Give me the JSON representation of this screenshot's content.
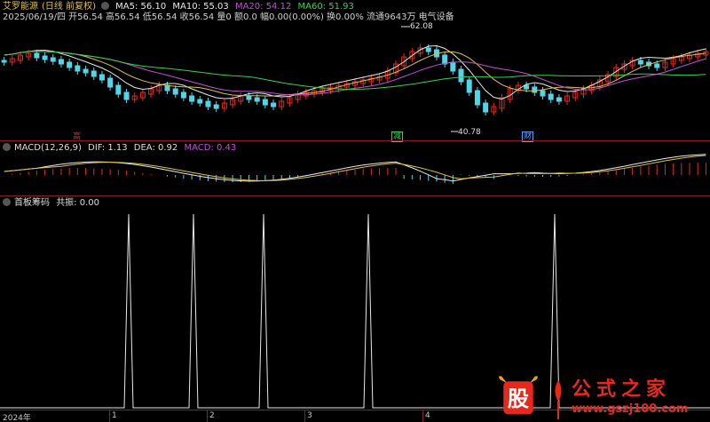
{
  "header": {
    "stock_name": "艾罗能源",
    "period": "(日线 前复权)",
    "ma": [
      {
        "label": "MA5: 56.10",
        "color": "#e8e8e8"
      },
      {
        "label": "MA10: 55.03",
        "color": "#e8e8e8"
      },
      {
        "label": "MA20: 54.12",
        "color": "#c34fd6"
      },
      {
        "label": "MA60: 51.93",
        "color": "#33d44a"
      }
    ],
    "quote": "2025/06/19/四 开56.54 高56.54 低56.54 收56.54 量0 额0.0 幅0.00(0.00%) 换0.00% 流通9643万 电气设备"
  },
  "price_panel": {
    "high_marker": "62.08",
    "low_marker": "40.78",
    "tags": [
      {
        "text": "高",
        "color": "#e8281b"
      },
      {
        "text": "减",
        "color": "#33d44a"
      },
      {
        "text": "财",
        "color": "#5aa0ff"
      }
    ]
  },
  "macd_panel": {
    "title": "MACD(12,26,9)",
    "dif": "DIF: 1.13",
    "dea": "DEA: 0.92",
    "macd": "MACD: 0.43"
  },
  "indicator_panel": {
    "title": "首板筹码",
    "value": "共振: 0.00"
  },
  "x_axis": {
    "labels": [
      "2024年",
      "1",
      "2",
      "3",
      "4"
    ]
  },
  "watermark": {
    "title": "公式之家",
    "url": "www.gszj100.com"
  },
  "chart_data": {
    "type": "line",
    "title": "",
    "series": [
      {
        "name": "共振",
        "values": [
          0,
          0,
          0,
          0,
          0,
          0,
          0,
          0,
          0,
          0,
          0,
          0,
          0,
          0,
          0,
          0,
          0,
          0,
          0,
          0,
          0,
          0,
          0,
          0,
          0,
          0,
          0,
          0,
          0,
          0,
          0,
          0,
          0,
          0,
          0,
          0,
          0,
          0,
          0,
          0,
          0,
          0,
          0,
          0,
          0,
          0,
          0,
          0,
          0,
          0,
          0,
          0,
          0,
          0,
          0,
          0,
          0,
          0,
          0,
          0,
          0,
          0,
          0,
          0,
          0,
          0,
          0,
          0,
          0,
          0,
          0,
          0,
          0,
          0,
          0,
          0,
          0,
          0,
          0,
          0,
          0,
          0,
          0,
          0,
          0,
          0,
          0,
          0,
          0,
          0,
          0,
          0,
          0,
          0,
          0,
          0,
          0,
          0,
          0,
          0,
          0,
          0,
          0,
          0,
          0,
          0,
          0,
          0,
          0,
          0,
          0,
          0,
          0,
          0,
          0,
          0,
          0,
          0,
          0,
          0,
          0,
          0,
          0,
          0,
          0,
          0,
          0,
          0,
          0,
          0,
          0,
          0,
          0,
          0,
          0,
          0,
          0,
          0,
          0,
          0,
          0,
          0,
          0,
          0,
          0,
          0,
          0,
          0,
          0,
          0,
          0,
          0,
          0,
          0,
          0,
          0,
          0,
          0,
          0,
          0,
          0,
          0,
          0,
          0
        ]
      }
    ],
    "xlabel": "",
    "ylabel": ""
  }
}
